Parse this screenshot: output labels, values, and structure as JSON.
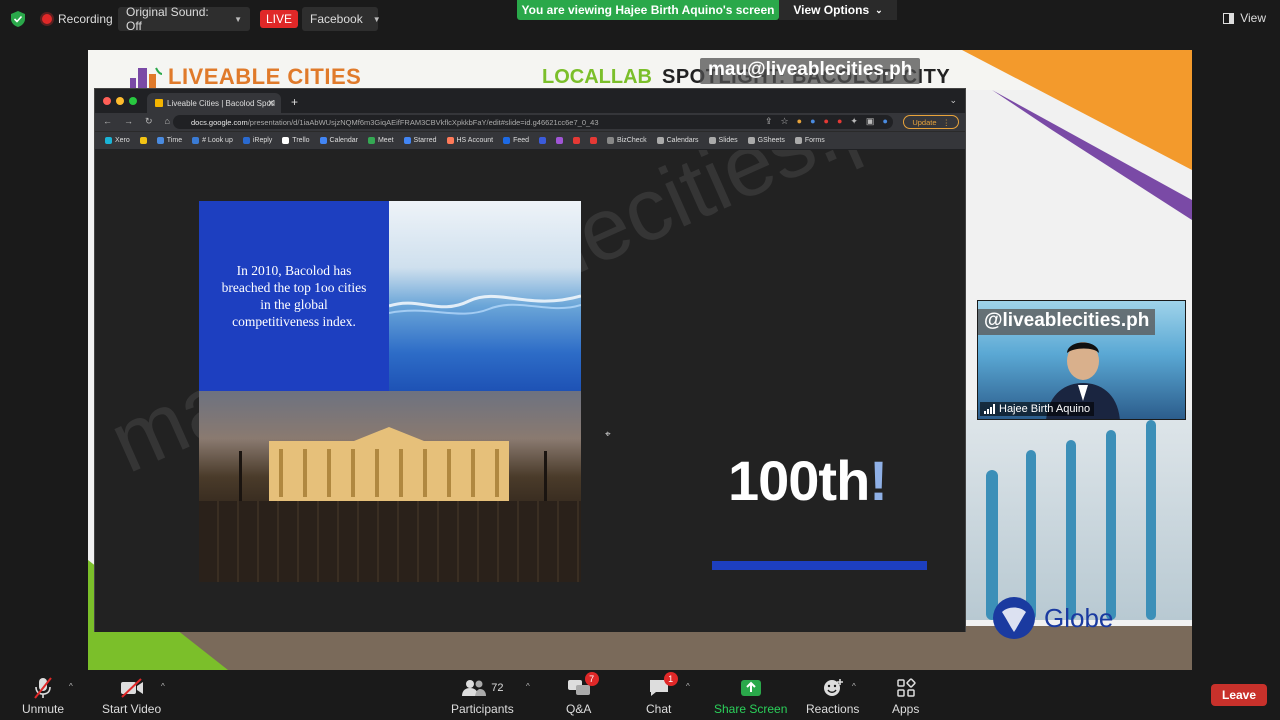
{
  "top_bar": {
    "recording_label": "Recording",
    "original_sound_label": "Original Sound: Off",
    "live_label": "LIVE",
    "facebook_label": "Facebook",
    "viewing_banner": "You are viewing Hajee Birth Aquino's screen",
    "view_options_label": "View Options",
    "view_label": "View"
  },
  "shared_screen": {
    "brand_left": "LIVEABLE CITIES",
    "brand_right_1": "LOCALLAB",
    "brand_right_2": "SPOTLIGHT: BACOLOD CITY",
    "overlay_handle": "mau@liveablecities.ph",
    "sponsor": "Globe"
  },
  "browser": {
    "tab_title": "Liveable Cities | Bacolod Spotl",
    "url_host": "docs.google.com",
    "url_path": "/presentation/d/1iaAbWUsjzNQMf6m3GiqAEifFRAM3CBVkflcXpkkbFaY/edit#slide=id.g46621cc6e7_0_43",
    "update_label": "Update",
    "bookmarks": [
      {
        "label": "Xero",
        "color": "#1ab4d7"
      },
      {
        "label": "",
        "color": "#f2c314"
      },
      {
        "label": "Time",
        "color": "#4a8be0"
      },
      {
        "label": "# Look up",
        "color": "#3a7bd5"
      },
      {
        "label": "iReply",
        "color": "#2a6ad0"
      },
      {
        "label": "Trello",
        "color": "#ffffff"
      },
      {
        "label": "Calendar",
        "color": "#4285f4"
      },
      {
        "label": "Meet",
        "color": "#34a853"
      },
      {
        "label": "Starred",
        "color": "#4285f4"
      },
      {
        "label": "HS Account",
        "color": "#ff7a59"
      },
      {
        "label": "Feed",
        "color": "#1d6ae5"
      },
      {
        "label": "",
        "color": "#3b5bdb"
      },
      {
        "label": "",
        "color": "#a055d6"
      },
      {
        "label": "",
        "color": "#e53935"
      },
      {
        "label": "",
        "color": "#e53935"
      },
      {
        "label": "BizCheck",
        "color": "#888888"
      },
      {
        "label": "Calendars",
        "color": "#aaaaaa"
      },
      {
        "label": "Slides",
        "color": "#aaaaaa"
      },
      {
        "label": "GSheets",
        "color": "#aaaaaa"
      },
      {
        "label": "Forms",
        "color": "#aaaaaa"
      }
    ]
  },
  "slide": {
    "body_text": "In 2010, Bacolod has breached the top 1oo cities in the global competitiveness index.",
    "headline": "100th",
    "headline_suffix": "!",
    "watermark": "mau@liveablecities.ph"
  },
  "speaker": {
    "handle": "@liveablecities.ph",
    "name": "Hajee Birth Aquino"
  },
  "toolbar": {
    "unmute": "Unmute",
    "start_video": "Start Video",
    "participants": "Participants",
    "participants_count": "72",
    "qa": "Q&A",
    "qa_badge": "7",
    "chat": "Chat",
    "chat_badge": "1",
    "share_screen": "Share Screen",
    "reactions": "Reactions",
    "apps": "Apps",
    "leave": "Leave"
  },
  "colors": {
    "accent_green": "#2aa84a",
    "live_red": "#e02828",
    "slide_blue": "#1d3fc0",
    "leave_red": "#c8312b"
  }
}
